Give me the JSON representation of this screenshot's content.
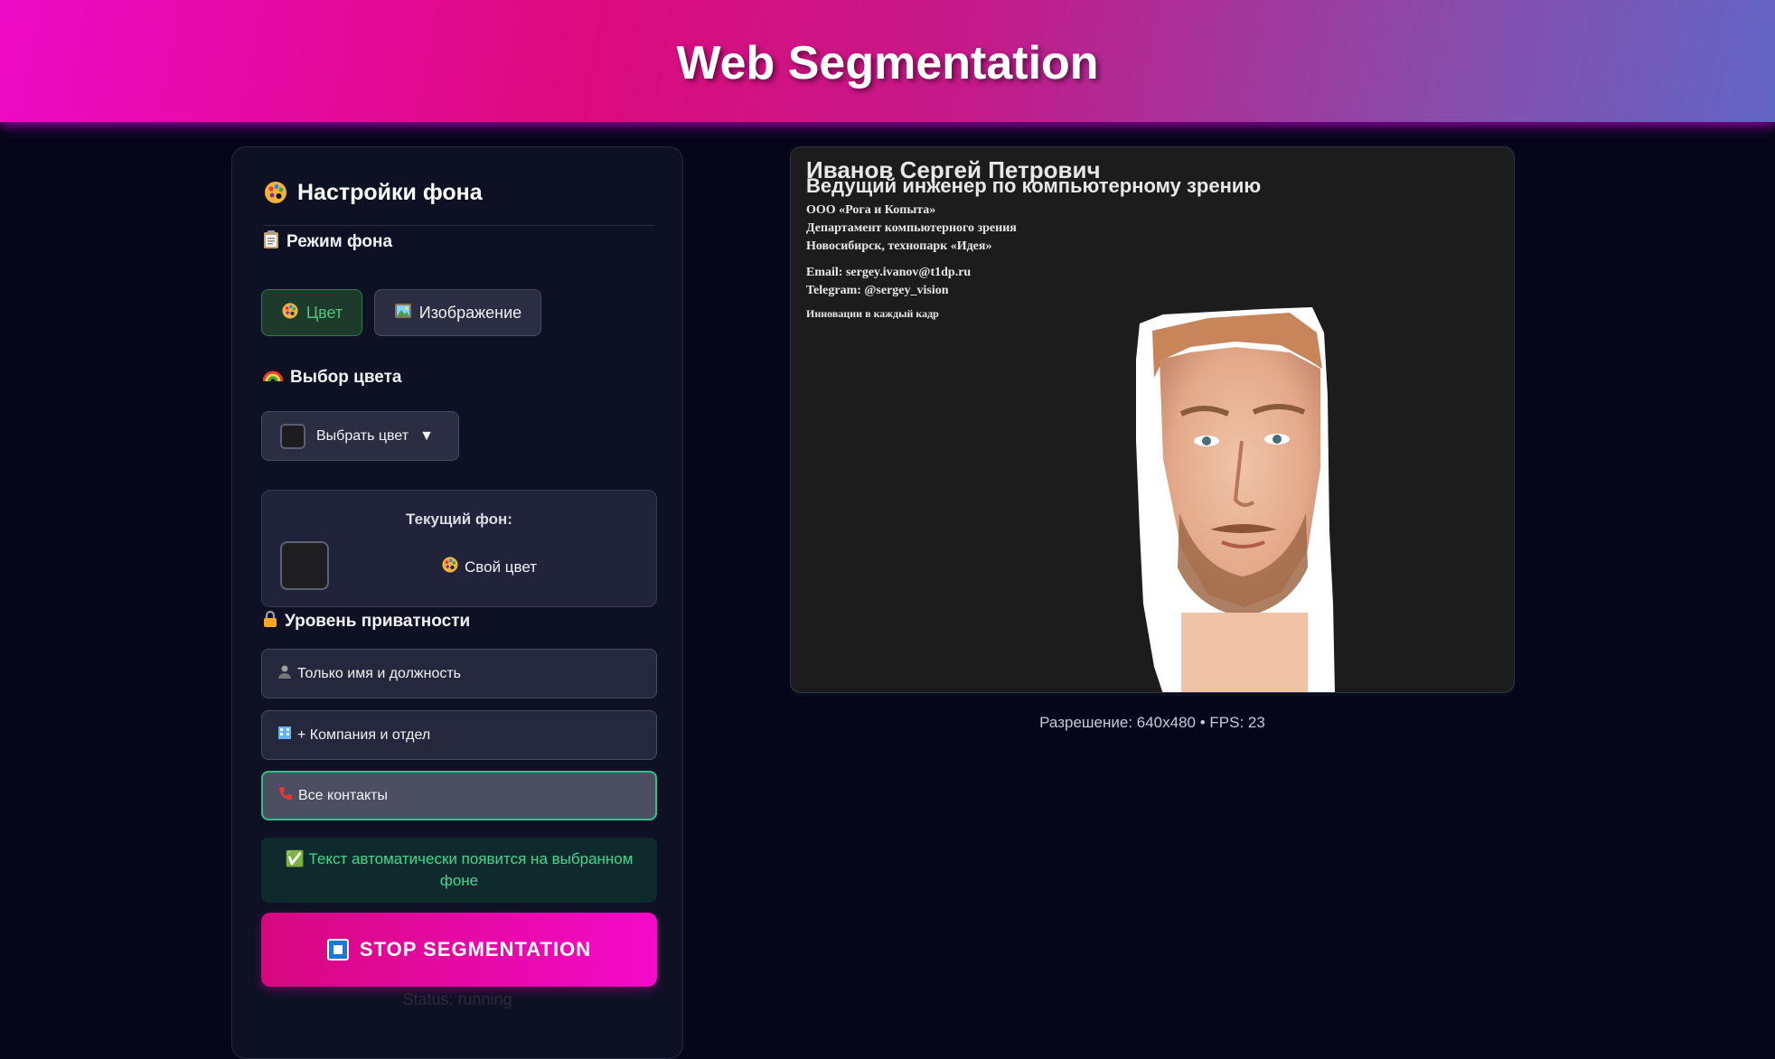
{
  "header": {
    "title": "Web Segmentation"
  },
  "settings": {
    "title": "Настройки фона",
    "title_icon": "palette-icon",
    "bg_mode": {
      "label": "Режим фона",
      "icon": "clipboard-icon",
      "options": [
        {
          "label": "Цвет",
          "icon": "palette-icon",
          "active": true
        },
        {
          "label": "Изображение",
          "icon": "picture-icon",
          "active": false
        }
      ]
    },
    "color_select": {
      "label": "Выбор цвета",
      "icon": "rainbow-icon",
      "button_label": "Выбрать цвет",
      "arrow": "▼",
      "swatch_color": "#1d1d20"
    },
    "current_bg": {
      "title": "Текущий фон:",
      "name": "Свой цвет",
      "icon": "palette-icon",
      "swatch_color": "#1e1e20"
    },
    "privacy": {
      "label": "Уровень приватности",
      "icon": "lock-icon",
      "options": [
        {
          "label": "Только имя и должность",
          "icon": "person-icon",
          "selected": false
        },
        {
          "label": "+ Компания и отдел",
          "icon": "building-icon",
          "selected": false
        },
        {
          "label": "Все контакты",
          "icon": "phone-icon",
          "selected": true
        }
      ]
    },
    "info": "✅ Текст автоматически появится на выбранном фоне",
    "stop_button": "STOP SEGMENTATION",
    "status": "Status: running"
  },
  "video": {
    "name": "Иванов Сергей Петрович",
    "role": "Ведущий инженер по компьютерному зрению",
    "company": "ООО «Рога и Копыта»",
    "department": "Департамент компьютерного зрения",
    "location": "Новосибирск, технопарк «Идея»",
    "email": "Email: sergey.ivanov@t1dp.ru",
    "telegram": "Telegram: @sergey_vision",
    "slogan": "Инновации в каждый кадр",
    "caption": "Разрешение: 640x480 • FPS: 23"
  },
  "colors": {
    "header_gradient": [
      "#ee0ac6",
      "#dc0a7c",
      "#6266c6"
    ],
    "page_bg": "#05061a",
    "accent_green": "#2ec08a",
    "stop_gradient": [
      "#d6087e",
      "#f40ac8"
    ]
  }
}
